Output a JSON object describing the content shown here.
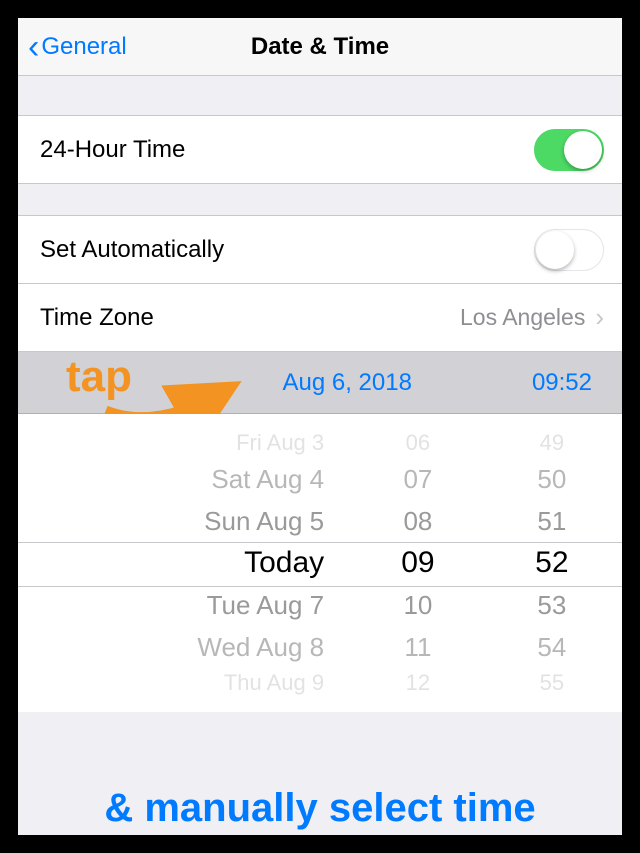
{
  "nav": {
    "back_label": "General",
    "title": "Date & Time"
  },
  "cells": {
    "hour24": {
      "label": "24-Hour Time",
      "on": true
    },
    "auto": {
      "label": "Set Automatically",
      "on": false
    },
    "tz": {
      "label": "Time Zone",
      "value": "Los Angeles"
    }
  },
  "selected": {
    "date": "Aug 6, 2018",
    "time": "09:52"
  },
  "picker": {
    "dates": [
      "Fri Aug 3",
      "Sat Aug 4",
      "Sun Aug 5",
      "Today",
      "Tue Aug 7",
      "Wed Aug 8",
      "Thu Aug 9"
    ],
    "hours": [
      "06",
      "07",
      "08",
      "09",
      "10",
      "11",
      "12"
    ],
    "mins": [
      "49",
      "50",
      "51",
      "52",
      "53",
      "54",
      "55"
    ]
  },
  "annotations": {
    "tap": "tap",
    "bottom": "& manually select time"
  }
}
